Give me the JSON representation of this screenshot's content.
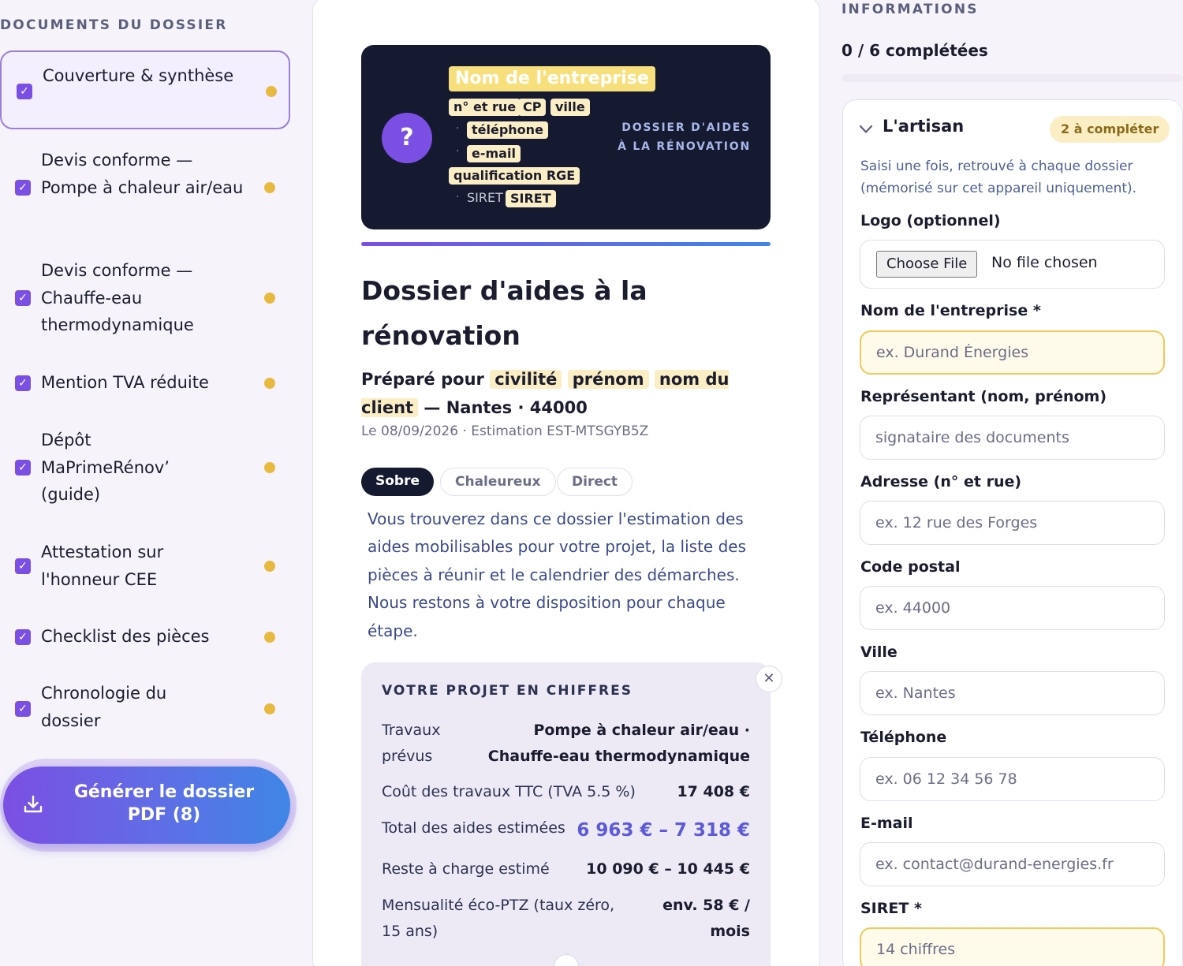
{
  "sidebar": {
    "title": "DOCUMENTS DU DOSSIER",
    "items": [
      {
        "label": "Couverture & synthèse"
      },
      {
        "label": "Devis conforme — Pompe à chaleur air/eau"
      },
      {
        "label": "Devis conforme — Chauffe-eau thermodynamique"
      },
      {
        "label": "Mention TVA réduite"
      },
      {
        "label": "Dépôt MaPrimeRénov’ (guide)"
      },
      {
        "label": "Attestation sur l'honneur CEE"
      },
      {
        "label": "Checklist des pièces"
      },
      {
        "label": "Chronologie du dossier"
      }
    ],
    "generate_label": "Générer le dossier PDF (8)",
    "checkbox_glyph": "✓",
    "accent_color": "#7b4fe3",
    "pending_dot_color": "#e8b93f"
  },
  "preview": {
    "hero": {
      "placeholder_icon": "?",
      "company_chip": "Nom de l'entreprise",
      "address_chip": "n° et rue",
      "cp_chip": "CP",
      "city_chip": "ville",
      "phone_chip": "téléphone",
      "email_chip": "e-mail",
      "rge_chip": "qualification RGE",
      "siret_label": "SIRET",
      "siret_chip": "SIRET",
      "bullet": "·",
      "right_line1": "DOSSIER D'AIDES",
      "right_line2": "À LA RÉNOVATION"
    },
    "title": "Dossier d'aides à la rénovation",
    "prepared_for": "Préparé pour",
    "civility_chip": "civilité",
    "firstname_chip": "prénom",
    "lastname_chip": "nom du client",
    "location": "— Nantes · 44000",
    "meta": "Le 08/09/2026 · Estimation EST-MTSGYB5Z",
    "tones": [
      "Sobre",
      "Chaleureux",
      "Direct"
    ],
    "selected_tone": "Sobre",
    "intro": "Vous trouverez dans ce dossier l'estimation des aides mobilisables pour votre projet, la liste des pièces à réunir et le calendrier des démarches. Nous restons à votre disposition pour chaque étape.",
    "figures": {
      "title": "VOTRE PROJET EN CHIFFRES",
      "close_glyph": "✕",
      "rows": [
        {
          "key": "Travaux prévus",
          "value": "Pompe à chaleur air/eau · Chauffe-eau thermodynamique"
        },
        {
          "key": "Coût des travaux TTC (TVA 5.5 %)",
          "value": "17 408 €"
        },
        {
          "key": "Total des aides estimées",
          "value": "6 963 € – 7 318 €"
        },
        {
          "key": "Reste à charge estimé",
          "value": "10 090 € – 10 445 €"
        },
        {
          "key": "Mensualité éco-PTZ (taux zéro, 15 ans)",
          "value": "env. 58 € / mois"
        }
      ]
    }
  },
  "info": {
    "title": "INFORMATIONS",
    "completed": "0 / 6 complétées",
    "completion_fraction": 0,
    "section": {
      "title": "L'artisan",
      "badge": "2 à compléter",
      "help": "Saisi une fois, retrouvé à chaque dossier (mémorisé sur cet appareil uniquement).",
      "logo_label": "Logo (optionnel)",
      "file_button": "Choose File",
      "file_status": "No file chosen",
      "fields": [
        {
          "label": "Nom de l'entreprise *",
          "placeholder": "ex. Durand Énergies",
          "value": "",
          "required": true
        },
        {
          "label": "Représentant (nom, prénom)",
          "placeholder": "signataire des documents",
          "value": "",
          "required": false
        },
        {
          "label": "Adresse (n° et rue)",
          "placeholder": "ex. 12 rue des Forges",
          "value": "",
          "required": false
        },
        {
          "label": "Code postal",
          "placeholder": "ex. 44000",
          "value": "",
          "required": false
        },
        {
          "label": "Ville",
          "placeholder": "ex. Nantes",
          "value": "",
          "required": false
        },
        {
          "label": "Téléphone",
          "placeholder": "ex. 06 12 34 56 78",
          "value": "",
          "required": false
        },
        {
          "label": "E-mail",
          "placeholder": "ex. contact@durand-energies.fr",
          "value": "",
          "required": false
        },
        {
          "label": "SIRET *",
          "placeholder": "14 chiffres",
          "value": "",
          "required": true
        }
      ]
    }
  }
}
